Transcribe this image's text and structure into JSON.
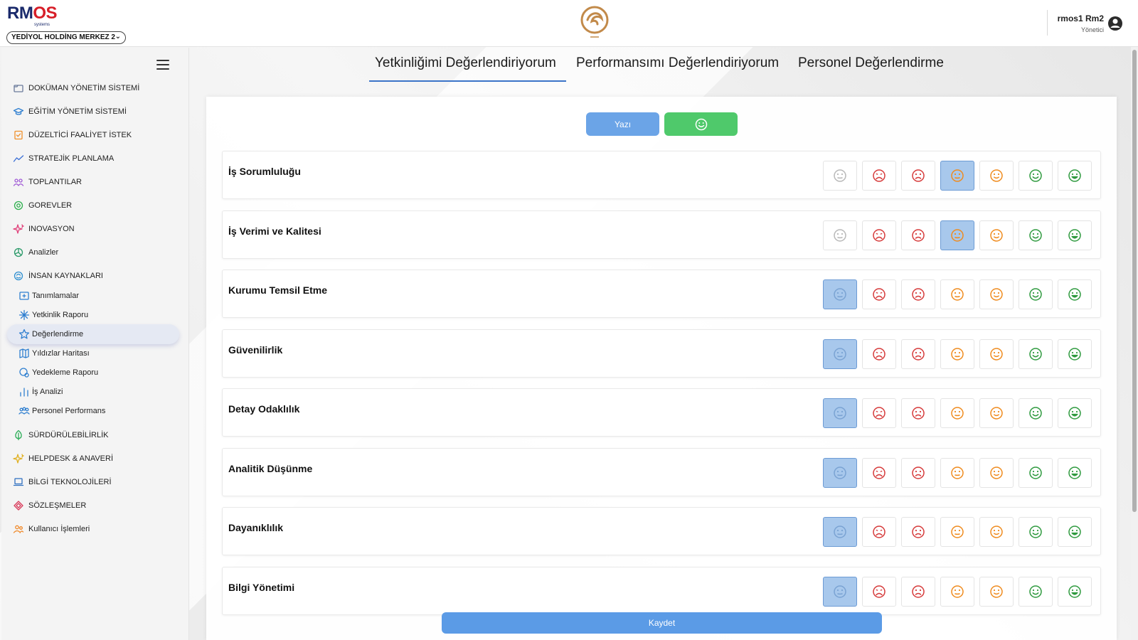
{
  "header": {
    "logo_text_a": "RM",
    "logo_text_b": "OS",
    "logo_sub": "systems",
    "company_select_value": "YEDİYOL HOLDİNG MERKEZ 2",
    "user_name": "rmos1 Rm2",
    "user_role": "Yönetici"
  },
  "sidebar": {
    "items": [
      {
        "label": "DOKÜMAN YÖNETİM SİSTEMİ",
        "icon": "folder-icon",
        "color": "#6a7a9a"
      },
      {
        "label": "EĞİTİM YÖNETİM SİSTEMİ",
        "icon": "graduation-cap-icon",
        "color": "#2f7fd0"
      },
      {
        "label": "DÜZELTİCİ FAALİYET İSTEK",
        "icon": "checklist-icon",
        "color": "#f0902a"
      },
      {
        "label": "STRATEJİK PLANLAMA",
        "icon": "trend-line-icon",
        "color": "#3a6fd6"
      },
      {
        "label": "TOPLANTILAR",
        "icon": "people-icon",
        "color": "#a05ad6"
      },
      {
        "label": "GOREVLER",
        "icon": "task-icon",
        "color": "#2fb04f"
      },
      {
        "label": "INOVASYON",
        "icon": "sparkle-icon",
        "color": "#e0407a"
      },
      {
        "label": "Analizler",
        "icon": "analytics-icon",
        "color": "#2c9a6a"
      },
      {
        "label": "İNSAN KAYNAKLARI",
        "icon": "hr-icon",
        "color": "#2f8fd0"
      }
    ],
    "subitems": [
      {
        "label": "Tanımlamalar",
        "icon": "definitions-icon",
        "color": "#2f7fd0"
      },
      {
        "label": "Yetkinlik Raporu",
        "icon": "report-icon",
        "color": "#2f7fd0"
      },
      {
        "label": "Değerlendirme",
        "icon": "star-icon",
        "color": "#2f7fd0"
      },
      {
        "label": "Yıldızlar Haritası",
        "icon": "map-icon",
        "color": "#2f7fd0"
      },
      {
        "label": "Yedekleme Raporu",
        "icon": "backup-icon",
        "color": "#2f7fd0"
      },
      {
        "label": "İş Analizi",
        "icon": "bar-chart-icon",
        "color": "#2f7fd0"
      },
      {
        "label": "Personel Performans",
        "icon": "team-icon",
        "color": "#2f7fd0"
      }
    ],
    "items_after": [
      {
        "label": "SÜRDÜRÜLEBİLİRLİK",
        "icon": "leaf-icon",
        "color": "#2fae5a"
      },
      {
        "label": "HELPDESK & ANAVERİ",
        "icon": "sparkle-icon",
        "color": "#e0b020"
      },
      {
        "label": "BİLGİ TEKNOLOJİLERİ",
        "icon": "laptop-icon",
        "color": "#2f6fc0"
      },
      {
        "label": "SÖZLEŞMELER",
        "icon": "contract-icon",
        "color": "#d83a5a"
      },
      {
        "label": "Kullanıcı İşlemleri",
        "icon": "users-icon",
        "color": "#f08a2a"
      }
    ]
  },
  "tabs": [
    {
      "label": "Yetkinliğimi Değerlendiriyorum",
      "active": true
    },
    {
      "label": "Performansımı Değerlendiriyorum",
      "active": false
    },
    {
      "label": "Personel Değerlendirme",
      "active": false
    }
  ],
  "toggle": {
    "text_label": "Yazı",
    "emoji_icon": "smiley-icon"
  },
  "rating_scale": [
    {
      "icon": "neutral-face-icon",
      "color": "#b8b8b8"
    },
    {
      "icon": "very-sad-face-icon",
      "color": "#d63a3a"
    },
    {
      "icon": "sad-face-icon",
      "color": "#d63a3a"
    },
    {
      "icon": "neutral-face-icon",
      "color": "#ef8b1e"
    },
    {
      "icon": "slight-smile-face-icon",
      "color": "#ef8b1e"
    },
    {
      "icon": "smile-face-icon",
      "color": "#2f9a3f"
    },
    {
      "icon": "big-smile-face-icon",
      "color": "#2f9a3f"
    }
  ],
  "criteria": [
    {
      "label": "İş Sorumluluğu",
      "selected": 3
    },
    {
      "label": "İş Verimi ve Kalitesi",
      "selected": 3
    },
    {
      "label": "Kurumu Temsil Etme",
      "selected": 0
    },
    {
      "label": "Güvenilirlik",
      "selected": 0
    },
    {
      "label": "Detay Odaklılık",
      "selected": 0
    },
    {
      "label": "Analitik Düşünme",
      "selected": 0
    },
    {
      "label": "Dayanıklılık",
      "selected": 0
    },
    {
      "label": "Bilgi Yönetimi",
      "selected": 0
    }
  ],
  "save_label": "Kaydet",
  "colors": {
    "accent_blue": "#5b9be6",
    "accent_green": "#4fc96b",
    "selected_bg": "#a8c8ec"
  }
}
